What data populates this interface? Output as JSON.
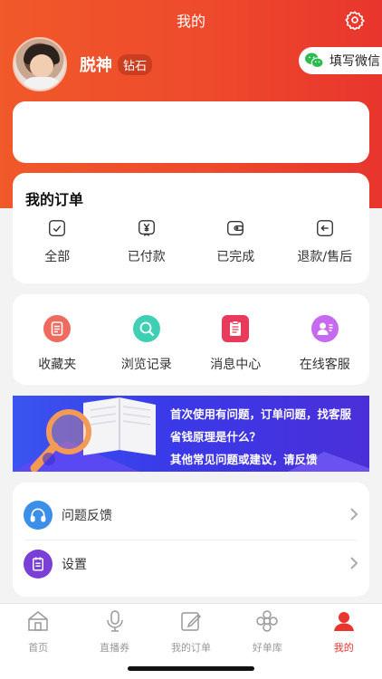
{
  "header": {
    "title": "我的",
    "settings_icon": "gear-icon"
  },
  "profile": {
    "name": "脱神",
    "level": "钻石",
    "wechat_button": "填写微信"
  },
  "orders": {
    "title": "我的订单",
    "items": [
      {
        "label": "全部",
        "icon": "check-box-icon"
      },
      {
        "label": "已付款",
        "icon": "yen-tag-icon"
      },
      {
        "label": "已完成",
        "icon": "wallet-icon"
      },
      {
        "label": "退款/售后",
        "icon": "return-icon"
      }
    ]
  },
  "tools": {
    "items": [
      {
        "label": "收藏夹",
        "icon": "favorites-icon",
        "color": "#ef6b5f"
      },
      {
        "label": "浏览记录",
        "icon": "search-icon",
        "color": "#3fcfb4"
      },
      {
        "label": "消息中心",
        "icon": "clipboard-icon",
        "color": "#ea3a5c"
      },
      {
        "label": "在线客服",
        "icon": "customer-service-icon",
        "color": "#c66af0"
      }
    ]
  },
  "banner": {
    "line1": "首次使用有问题，订单问题，找客服",
    "line2": "省钱原理是什么？",
    "line3": "其他常见问题或建议，请反馈"
  },
  "menu": {
    "items": [
      {
        "label": "问题反馈",
        "icon": "headphones-icon",
        "color": "#3b8fe8"
      },
      {
        "label": "设置",
        "icon": "notepad-icon",
        "color": "#7a3fd6"
      }
    ]
  },
  "tabbar": {
    "items": [
      {
        "label": "首页",
        "icon": "home-icon"
      },
      {
        "label": "直播券",
        "icon": "microphone-icon"
      },
      {
        "label": "我的订单",
        "icon": "edit-icon"
      },
      {
        "label": "好单库",
        "icon": "flower-icon"
      },
      {
        "label": "我的",
        "icon": "person-icon",
        "active": true
      }
    ]
  },
  "colors": {
    "brand": "#ee4a2c",
    "active_tab": "#e8352d"
  }
}
